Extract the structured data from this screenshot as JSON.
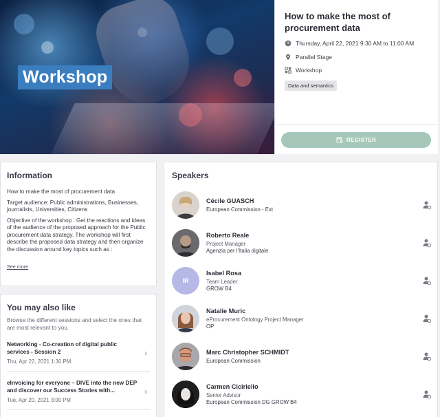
{
  "hero": {
    "badge": "Workshop"
  },
  "event": {
    "title": "How to make the most of procurement data",
    "datetime": "Thursday, April 22, 2021 9:30 AM to 11:00 AM",
    "location": "Parallel Stage",
    "type": "Workshop",
    "tag": "Data and semantics",
    "register_label": "REGISTER"
  },
  "info": {
    "heading": "Information",
    "paragraphs": [
      "How to make the most of procurement data",
      "Target audience: Public administrations, Businesses, journalists, Universities, Citizens",
      "Objective of the workshop : Get the reactions and ideas of the audience of the proposed approach for the Public procurement data strategy. The workshop will first describe the proposed data strategy and then organize the discussion around key topics such as :"
    ],
    "see_more": "See more"
  },
  "also": {
    "heading": "You may also like",
    "subtitle": "Browse the different sessions and select the ones that are most relevant to you.",
    "sessions": [
      {
        "title": "Networking - Co-creation of digital public services - Session 2",
        "date": "Thu, Apr 22, 2021 1:30 PM"
      },
      {
        "title": "eInvoicing for everyone – DIVE into the new DEP and discover our Success Stories with...",
        "date": "Tue, Apr 20, 2021 3:00 PM"
      }
    ]
  },
  "speakers": {
    "heading": "Speakers",
    "list": [
      {
        "name": "Cécile GUASCH",
        "role": "",
        "org": "European Commission - Ext",
        "avatar": "photo",
        "color": "#cfc9c2"
      },
      {
        "name": "Roberto Reale",
        "role": "Project Manager",
        "org": "Agenzia per l'Italia digitale",
        "avatar": "photo",
        "color": "#5a5a5e"
      },
      {
        "name": "Isabel Rosa",
        "role": "Team Leader",
        "org": "GROW B4",
        "avatar": "IR",
        "color": "#b6b8e6"
      },
      {
        "name": "Natalie Muric",
        "role": "eProcurement Ontology Project Manager",
        "org": "OP",
        "avatar": "photo",
        "color": "#c79a86"
      },
      {
        "name": "Marc Christopher SCHMIDT",
        "role": "",
        "org": "European Commission",
        "avatar": "photo",
        "color": "#c8866a"
      },
      {
        "name": "Carmen Ciciriello",
        "role": "Senior Advisor",
        "org": "European Commission DG GROW B4",
        "avatar": "photo",
        "color": "#3b3b3e"
      }
    ]
  },
  "colors": {
    "register_bg": "#a6c7b9",
    "avatar_initials_bg": "#b6b8e6",
    "badge_bg": "#3b7ec0"
  }
}
